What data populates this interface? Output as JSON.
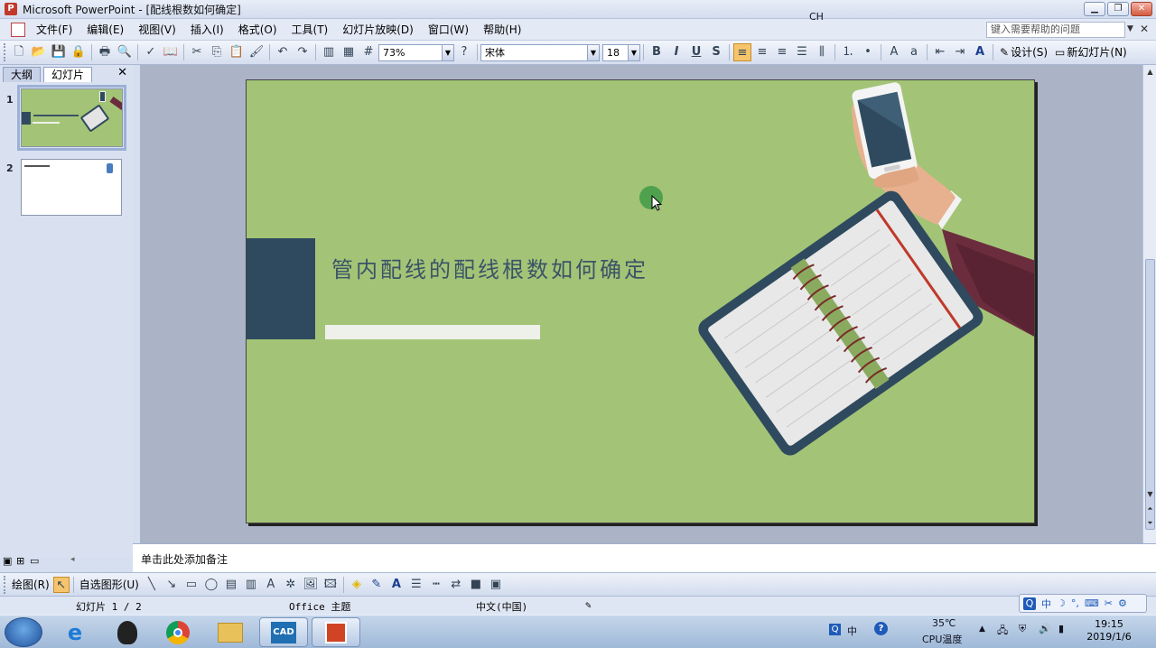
{
  "window": {
    "title": "Microsoft PowerPoint - [配线根数如何确定]",
    "buttons": [
      "minimize",
      "restore",
      "close"
    ]
  },
  "menu": {
    "items": [
      "文件(F)",
      "编辑(E)",
      "视图(V)",
      "插入(I)",
      "格式(O)",
      "工具(T)",
      "幻灯片放映(D)",
      "窗口(W)",
      "帮助(H)"
    ],
    "help_placeholder": "键入需要帮助的问题"
  },
  "toolbar": {
    "zoom": "73%",
    "font_name": "宋体",
    "font_size": "18",
    "bold": "B",
    "italic": "I",
    "underline": "U",
    "shadow": "S",
    "design_label": "设计(S)",
    "new_slide_label": "新幻灯片(N)"
  },
  "left_pane": {
    "tabs": [
      "大纲",
      "幻灯片"
    ],
    "active_tab": "幻灯片",
    "slides": [
      {
        "number": "1",
        "selected": true
      },
      {
        "number": "2",
        "selected": false
      }
    ]
  },
  "slide": {
    "title": "管内配线的配线根数如何确定",
    "background": "#a3c476",
    "accent": "#2f4a5e"
  },
  "notes": {
    "placeholder": "单击此处添加备注"
  },
  "draw_toolbar": {
    "draw_label": "绘图(R)",
    "autoshape_label": "自选图形(U)"
  },
  "status": {
    "slide_counter": "幻灯片 1 / 2",
    "theme": "Office 主题",
    "language": "中文(中国)"
  },
  "ime": {
    "items": [
      "中",
      "☽",
      "°,",
      "⌨",
      "✂",
      "⚙"
    ]
  },
  "taskbar": {
    "apps": [
      "ie-app",
      "qq-app",
      "chrome-app",
      "explorer-app",
      "cad-app",
      "powerpoint-app"
    ],
    "cad_label": "CAD",
    "tray": {
      "lang": "CH",
      "ime_char": "中",
      "temp": "35℃",
      "temp_label": "CPU温度",
      "time": "19:15",
      "date": "2019/1/6"
    }
  }
}
